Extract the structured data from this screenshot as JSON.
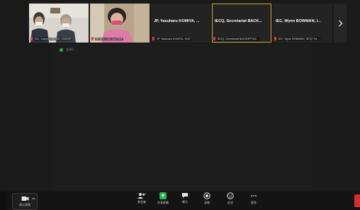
{
  "tiles": [
    {
      "big_name": "",
      "caption": "VIC, Joseph CHENG, CNGOP"
    },
    {
      "big_name": "",
      "caption": "JP, IEC, LGL CyCHOP"
    },
    {
      "big_name": "JP, Yasuharu KOMIYA, ...",
      "caption": "JP, Yasuharu KOMIYA, HoD"
    },
    {
      "big_name": "IECQ, Secretariat BACK...",
      "caption": "IECQ, Secretariat BACKOFFICE..."
    },
    {
      "big_name": "IEC, Wynn BOWMAN, I...",
      "caption": "IEC, Wynn BOWMAN, IECQ Tre..."
    }
  ],
  "main": {
    "active_label": "主讲人"
  },
  "toolbar": {
    "video_label": "停止视频",
    "participants_count": "7",
    "participants_label": "参会者",
    "share_label": "共享屏幕",
    "chat_label": "聊天",
    "record_label": "录制",
    "reactions_label": "反应",
    "more_label": "更多"
  },
  "colors": {
    "speaking_border": "#c9b037",
    "share_green": "#2bb24c",
    "end_red": "#d52e2e",
    "mic_muted": "#e23a3a"
  }
}
